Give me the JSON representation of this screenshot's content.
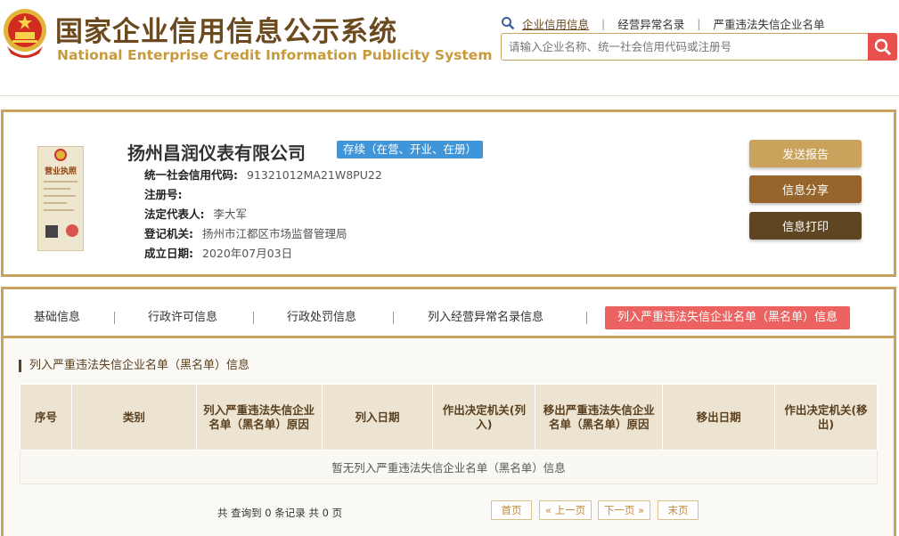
{
  "header": {
    "title_cn": "国家企业信用信息公示系统",
    "title_en": "National Enterprise Credit Information Publicity System",
    "links": [
      "企业信用信息",
      "经营异常名录",
      "严重违法失信企业名单"
    ],
    "search_placeholder": "请输入企业名称、统一社会信用代码或注册号"
  },
  "license": {
    "title": "营业执照"
  },
  "company": {
    "name": "扬州昌润仪表有限公司",
    "status": "存续（在营、开业、在册）",
    "fields": [
      {
        "label": "统一社会信用代码:",
        "value": "91321012MA21W8PU22"
      },
      {
        "label": "注册号:",
        "value": ""
      },
      {
        "label": "法定代表人:",
        "value": "李大军"
      },
      {
        "label": "登记机关:",
        "value": "扬州市江都区市场监督管理局"
      },
      {
        "label": "成立日期:",
        "value": "2020年07月03日"
      }
    ]
  },
  "actions": {
    "send_report": "发送报告",
    "share": "信息分享",
    "print": "信息打印"
  },
  "tabs": [
    "基础信息",
    "行政许可信息",
    "行政处罚信息",
    "列入经营异常名录信息",
    "列入严重违法失信企业名单（黑名单）信息"
  ],
  "section": {
    "title": "列入严重违法失信企业名单（黑名单）信息",
    "columns": [
      "序号",
      "类别",
      "列入严重违法失信企业名单（黑名单）原因",
      "列入日期",
      "作出决定机关(列入)",
      "移出严重违法失信企业名单（黑名单）原因",
      "移出日期",
      "作出决定机关(移出)"
    ],
    "empty_text": "暂无列入严重违法失信企业名单（黑名单）信息"
  },
  "pager": {
    "summary": "共 查询到 0 条记录 共 0 页",
    "first": "首页",
    "prev": "« 上一页",
    "next": "下一页 »",
    "last": "末页"
  },
  "colors": {
    "gold": "#c9a35c",
    "brown": "#6b4a1f",
    "active_tab": "#ec6261",
    "status_blue": "#3f95d8"
  }
}
